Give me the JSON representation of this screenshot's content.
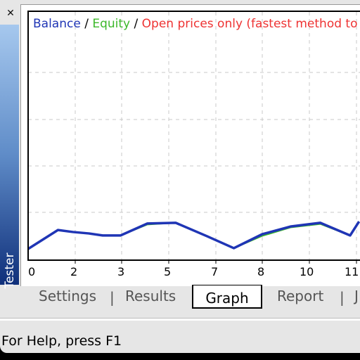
{
  "window": {
    "close_icon": "close-icon",
    "sidebar_label": "Tester"
  },
  "legend": {
    "balance": "Balance",
    "sep1": "/",
    "equity": "Equity",
    "sep2": "/",
    "model": "Open prices only (fastest method to"
  },
  "colors": {
    "balance": "#1f35b5",
    "equity": "#3cb82a",
    "model": "#ee3333"
  },
  "chart_data": {
    "type": "line",
    "title": "",
    "xlabel": "",
    "ylabel": "",
    "x_tick_labels": [
      "0",
      "2",
      "3",
      "5",
      "7",
      "8",
      "10",
      "11"
    ],
    "grid": true,
    "y_axis_labels_shown": false,
    "ylim": [
      0,
      100
    ],
    "series": [
      {
        "name": "Balance",
        "x": [
          0,
          1.0,
          1.5,
          2.05,
          2.5,
          3.1,
          4.0,
          4.95,
          6.0,
          6.9,
          7.85,
          8.8,
          9.8,
          10.8,
          11.1
        ],
        "y": [
          4.8,
          12.4,
          11.6,
          11.0,
          10.2,
          10.2,
          15.0,
          15.3,
          9.9,
          5.1,
          10.7,
          13.8,
          15.3,
          10.2,
          15.8
        ]
      },
      {
        "name": "Equity",
        "x": [
          0,
          1.0,
          1.5,
          2.05,
          2.5,
          3.1,
          4.0,
          4.95,
          6.0,
          6.9,
          7.85,
          8.8,
          9.8,
          10.8,
          11.1
        ],
        "y": [
          4.8,
          12.4,
          11.6,
          11.0,
          10.2,
          10.2,
          14.6,
          15.3,
          9.9,
          5.1,
          10.0,
          13.4,
          14.8,
          10.2,
          15.8
        ]
      }
    ]
  },
  "tabs": {
    "settings": "Settings",
    "results": "Results",
    "graph": "Graph",
    "report": "Report",
    "journal_partial": "J",
    "separator": "|"
  },
  "status": {
    "text": "For Help, press F1"
  }
}
